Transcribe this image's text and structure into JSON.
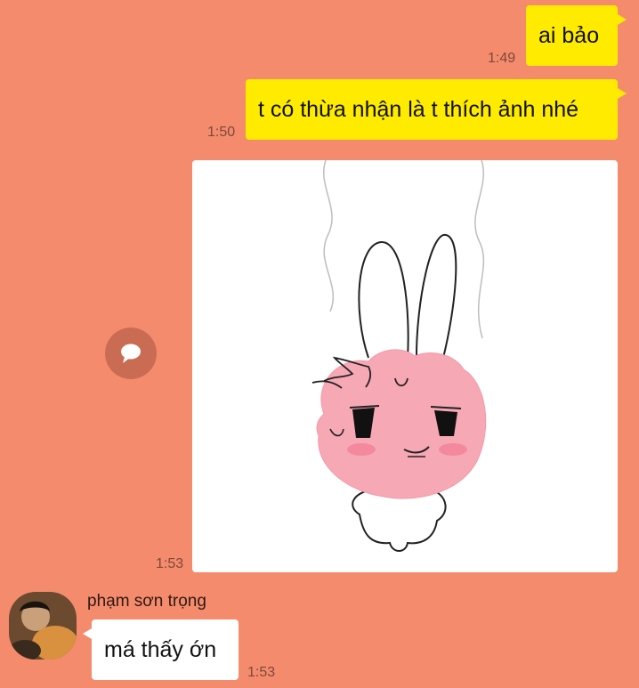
{
  "messages": [
    {
      "text": "ai bảo",
      "time": "1:49",
      "side": "right"
    },
    {
      "text": "t có thừa nhận là t thích ảnh nhé",
      "time": "1:50",
      "side": "right"
    },
    {
      "sticker": "pink-bunny-smirk-sticker",
      "time": "1:53",
      "side": "right"
    },
    {
      "sender": "phạm sơn trọng",
      "text": "má thấy ớn",
      "time": "1:53",
      "side": "left"
    }
  ],
  "icons": {
    "share": "speech-bubble-icon",
    "avatar": "user-avatar-photo"
  },
  "colors": {
    "background": "#F58B6D",
    "my_bubble": "#FFEB00",
    "their_bubble": "#FFFFFF",
    "sticker_pink": "#F7A8B5"
  }
}
